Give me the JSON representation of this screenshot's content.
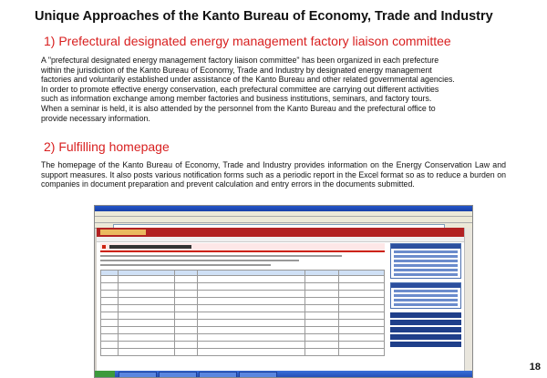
{
  "title": "Unique Approaches of the Kanto Bureau of Economy, Trade and Industry",
  "section1": {
    "heading": "1) Prefectural designated energy management factory liaison committee",
    "lines": [
      "A \"prefectural designated energy management factory liaison committee\" has been organized in each prefecture",
      "within the jurisdiction of the Kanto Bureau of Economy, Trade and Industry by designated energy management",
      "factories and voluntarily established under assistance of the Kanto Bureau and other related governmental agencies.",
      "In order to promote effective energy conservation, each prefectural committee are carrying out different activities",
      "such as information exchange among member factories and business institutions, seminars, and factory tours.",
      "When a seminar is held, it is also attended by the personnel from the Kanto Bureau and the prefectural office to",
      "provide necessary information."
    ]
  },
  "section2": {
    "heading": "2) Fulfilling homepage",
    "text": "The homepage of the Kanto Bureau of Economy, Trade and Industry provides information on the Energy Conservation Law and support measures. It also posts various notification forms such as a periodic report in the Excel format so as to reduce a burden on companies in document preparation and prevent calculation and entry errors in the documents submitted."
  },
  "page_number": "18"
}
